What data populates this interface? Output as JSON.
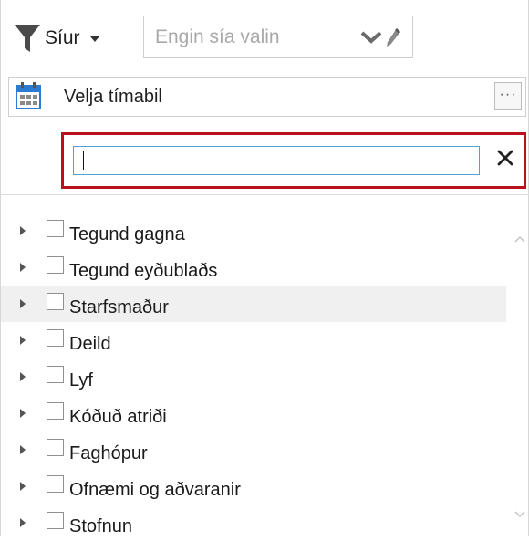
{
  "filter": {
    "button_label": "Síur",
    "select_placeholder": "Engin sía valin"
  },
  "period": {
    "label": "Velja tímabil",
    "more_label": "···"
  },
  "search": {
    "value": "",
    "clear_label": "✕"
  },
  "tree": {
    "items": [
      {
        "label": "Tegund gagna",
        "checked": false
      },
      {
        "label": "Tegund eyðublaðs",
        "checked": false
      },
      {
        "label": "Starfsmaður",
        "checked": false
      },
      {
        "label": "Deild",
        "checked": false
      },
      {
        "label": "Lyf",
        "checked": false
      },
      {
        "label": "Kóðuð atriði",
        "checked": false
      },
      {
        "label": "Faghópur",
        "checked": false
      },
      {
        "label": "Ofnæmi og aðvaranir",
        "checked": false
      },
      {
        "label": "Stofnun",
        "checked": false
      }
    ],
    "highlighted_index": 2
  },
  "colors": {
    "search_border": "#b8121c",
    "input_focus_border": "#4da3d8",
    "calendar_accent": "#2b7bd1",
    "row_highlight": "#f0f0f0"
  },
  "icons": {
    "filter": "funnel-icon",
    "dropdown": "caret-down-icon",
    "select_chevron": "chevron-down-icon",
    "edit": "pencil-icon",
    "calendar": "calendar-icon",
    "more": "ellipsis-icon",
    "clear": "close-icon",
    "expand": "triangle-right-icon"
  }
}
